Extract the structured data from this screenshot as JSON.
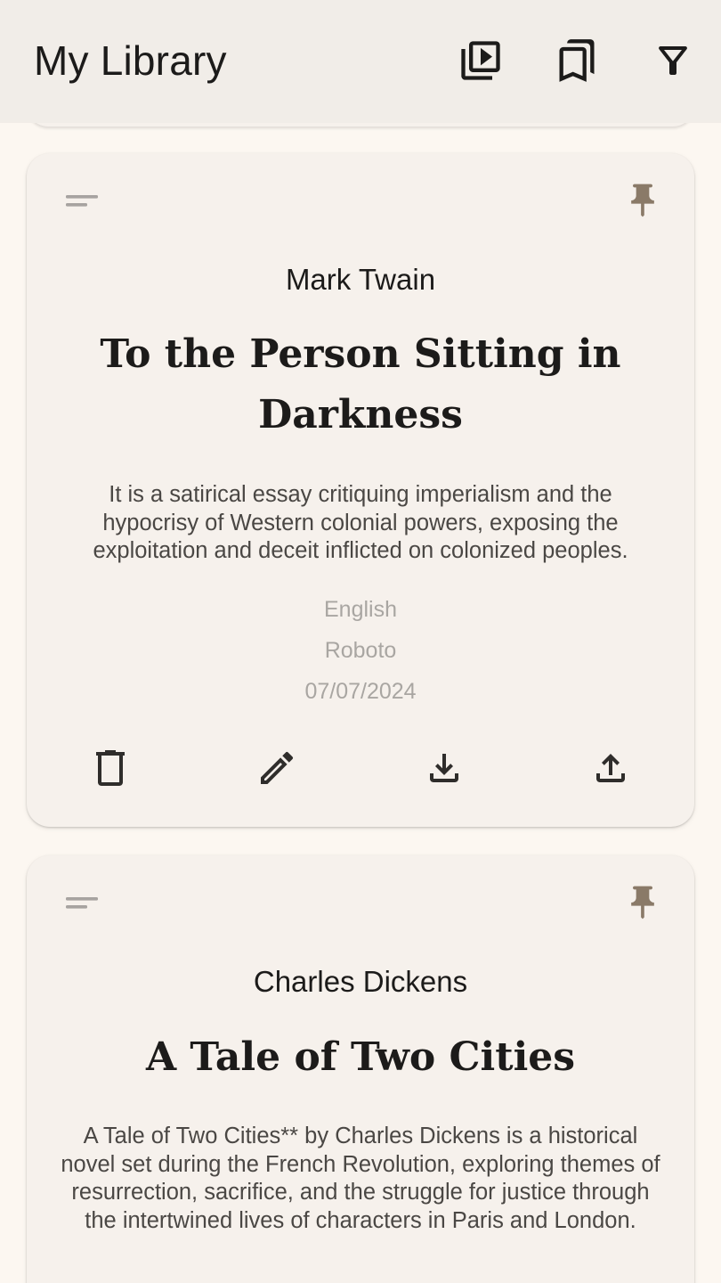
{
  "app_bar": {
    "title": "My Library",
    "actions": [
      {
        "icon": "video-library-icon"
      },
      {
        "icon": "bookmarks-icon"
      },
      {
        "icon": "filter-icon"
      }
    ]
  },
  "colors": {
    "app_bar_bg": "#f1ede8",
    "page_bg": "#fcf7f1",
    "card_bg": "#f6f1ec",
    "pin": "#8a7a68",
    "meta_text": "#a9a6a2"
  },
  "books": [
    {
      "author": "Mark Twain",
      "title": "To the Person Sitting in Darkness",
      "description": "It is a satirical essay critiquing imperialism and the hypocrisy of Western colonial powers, exposing the exploitation and deceit inflicted on colonized peoples.",
      "language": "English",
      "font": "Roboto",
      "date": "07/07/2024",
      "actions": [
        "delete-icon",
        "edit-icon",
        "download-icon",
        "upload-icon"
      ]
    },
    {
      "author": "Charles Dickens",
      "title": "A Tale of Two Cities",
      "description": "A Tale of Two Cities** by Charles Dickens is a historical novel set during the French Revolution, exploring themes of resurrection, sacrifice, and the struggle for justice through the intertwined lives of characters in Paris and London."
    }
  ]
}
